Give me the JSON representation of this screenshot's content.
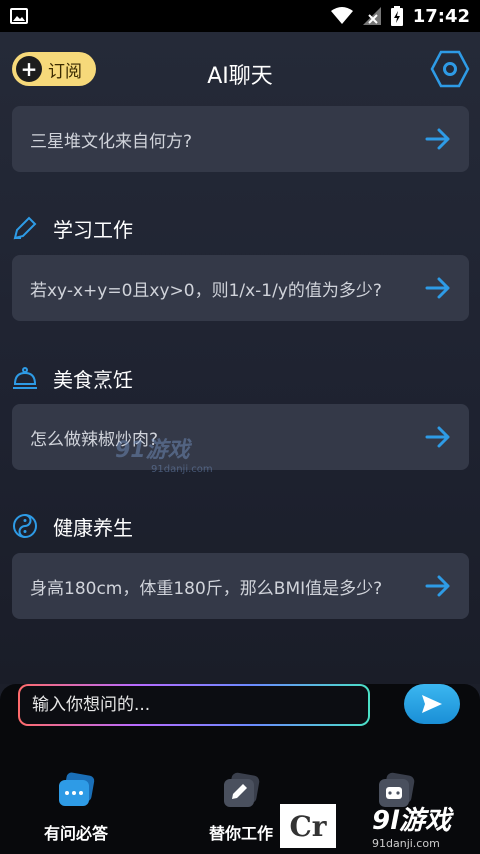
{
  "status": {
    "time": "17:42"
  },
  "header": {
    "subscribe_label": "订阅",
    "title": "AI聊天"
  },
  "cards": [
    {
      "question": "三星堆文化来自何方?"
    },
    {
      "question": "若xy-x+y=0且xy>0，则1/x-1/y的值为多少?"
    },
    {
      "question": "怎么做辣椒炒肉?"
    },
    {
      "question": "身高180cm，体重180斤，那么BMI值是多少?"
    }
  ],
  "sections": [
    {
      "title": "学习工作",
      "icon": "pencil-icon"
    },
    {
      "title": "美食烹饪",
      "icon": "food-cloche-icon"
    },
    {
      "title": "健康养生",
      "icon": "yin-yang-icon"
    }
  ],
  "input": {
    "placeholder": "输入你想问的..."
  },
  "nav": [
    {
      "label": "有问必答",
      "icon": "chat-bubble-icon"
    },
    {
      "label": "替你工作",
      "icon": "edit-icon"
    },
    {
      "label": "",
      "icon": "robot-icon"
    }
  ],
  "watermarks": {
    "center": "91游戏",
    "center_small": "91danji.com",
    "br_big": "9l游戏",
    "br_small": "91danji.com",
    "cr": "Cr"
  },
  "colors": {
    "accent": "#2e9be6",
    "subscribe": "#f6d97a",
    "card": "#343948"
  }
}
